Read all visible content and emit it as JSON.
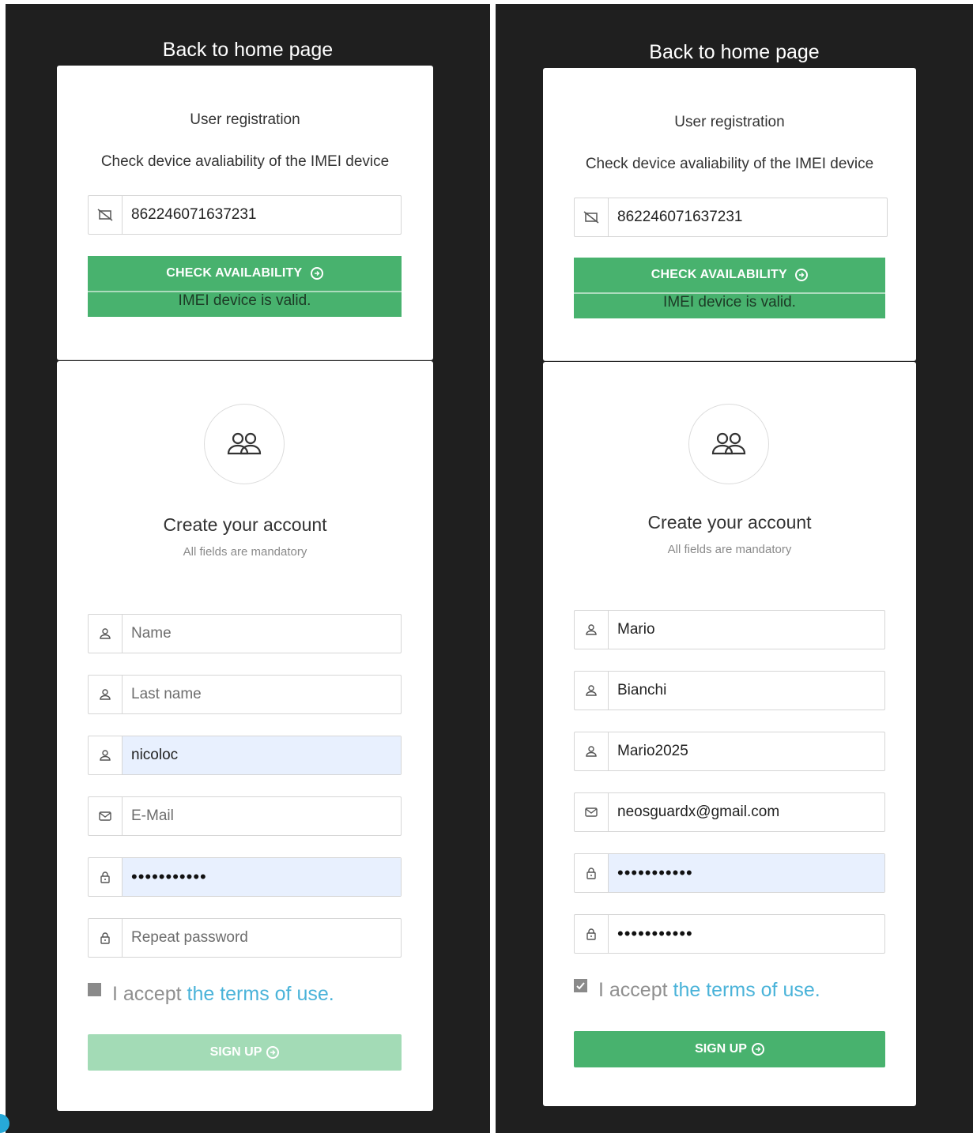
{
  "left": {
    "back_link": "Back to home page",
    "registration_title": "User registration",
    "check_subtitle": "Check device avaliability of the IMEI device",
    "imei_value": "862246071637231",
    "check_button": "CHECK AVAILABILITY",
    "valid_message": "IMEI device is valid.",
    "create_title": "Create your account",
    "mandatory_note": "All fields are mandatory",
    "name_placeholder": "Name",
    "lastname_placeholder": "Last name",
    "username_value": "nicoloc",
    "email_placeholder": "E-Mail",
    "password_value": "•••••••••••",
    "repeat_placeholder": "Repeat password",
    "terms_prefix": "I accept ",
    "terms_link": "the terms of use",
    "terms_suffix": ".",
    "terms_checked": false,
    "signup_button": "SIGN UP",
    "signup_enabled": false
  },
  "right": {
    "back_link": "Back to home page",
    "registration_title": "User registration",
    "check_subtitle": "Check device avaliability of the IMEI device",
    "imei_value": "862246071637231",
    "check_button": "CHECK AVAILABILITY",
    "valid_message": "IMEI device is valid.",
    "create_title": "Create your account",
    "mandatory_note": "All fields are mandatory",
    "name_value": "Mario",
    "lastname_value": "Bianchi",
    "username_value": "Mario2025",
    "email_value": "neosguardx@gmail.com",
    "password_value": "•••••••••••",
    "repeat_value": "•••••••••••",
    "terms_prefix": "I accept ",
    "terms_link": "the terms of use",
    "terms_suffix": ".",
    "terms_checked": true,
    "signup_button": "SIGN UP",
    "signup_enabled": true
  },
  "colors": {
    "panel_bg": "#1f1f1f",
    "accent_green": "#48b26e",
    "disabled_green": "#a3dbb6",
    "link_blue": "#4ab3d9",
    "autofill_bg": "#e8f0fe"
  },
  "icons": {
    "imei": "no-phone-icon",
    "person": "user-icon",
    "email": "envelope-icon",
    "password": "lock-icon",
    "avatar": "users-group-icon",
    "arrow": "circle-arrow-right-icon"
  }
}
